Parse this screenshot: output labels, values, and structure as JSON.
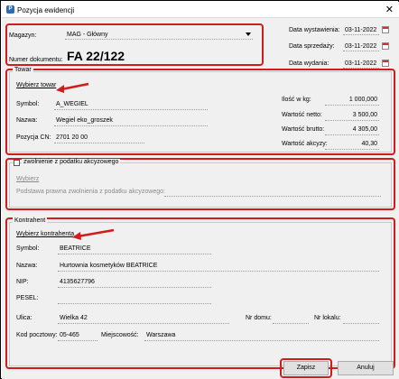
{
  "window": {
    "title": "Pozycja ewidencji",
    "close_glyph": "✕",
    "icon": "app-icon"
  },
  "header": {
    "magazyn_label": "Magazyn:",
    "magazyn_value": "MAG - Główny",
    "numer_label": "Numer dokumentu:",
    "numer_value": "FA 22/122",
    "data_wystawienia_label": "Data wystawienia:",
    "data_wystawienia_value": "03-11-2022",
    "data_sprzedazy_label": "Data sprzedaży:",
    "data_sprzedazy_value": "03-11-2022",
    "data_wydania_label": "Data wydania:",
    "data_wydania_value": "03-11-2022"
  },
  "towar": {
    "legend": "Towar",
    "choose_link": "Wybierz towar",
    "symbol_label": "Symbol:",
    "symbol_value": "A_WEGIEL",
    "nazwa_label": "Nazwa:",
    "nazwa_value": "Wegiel eko_groszek",
    "cn_label": "Pozycja CN:",
    "cn_value": "2701 20 00",
    "ilosc_label": "Ilość w kg:",
    "ilosc_value": "1 000,000",
    "netto_label": "Wartość netto:",
    "netto_value": "3 500,00",
    "brutto_label": "Wartość brutto:",
    "brutto_value": "4 305,00",
    "akcyza_label": "Wartość akcyzy:",
    "akcyza_value": "40,30"
  },
  "zwolnienie": {
    "checkbox_label": "zwolnienie z podatku akcyzowego",
    "choose_link": "Wybierz",
    "podstawa_label": "Podstawa prawna zwolnienia z podatku akcyzowego:"
  },
  "kontrahent": {
    "legend": "Kontrahent",
    "choose_link": "Wybierz kontrahenta",
    "symbol_label": "Symbol:",
    "symbol_value": "BEATRICE",
    "nazwa_label": "Nazwa:",
    "nazwa_value": "Hurtownia kosmetyków BEATRICE",
    "nip_label": "NIP:",
    "nip_value": "4135627796",
    "pesel_label": "PESEL:",
    "pesel_value": "",
    "ulica_label": "Ulica:",
    "ulica_value": "Wielka  42",
    "nr_domu_label": "Nr domu:",
    "nr_lokalu_label": "Nr lokalu:",
    "kod_label": "Kod pocztowy:",
    "kod_value": "05-465",
    "miejscowosc_label": "Miejscowość:",
    "miejscowosc_value": "Warszawa"
  },
  "buttons": {
    "save": "Zapisz",
    "cancel": "Anuluj"
  },
  "colors": {
    "highlight": "#d21b1b",
    "dialog_bg": "#f0f0f0"
  }
}
